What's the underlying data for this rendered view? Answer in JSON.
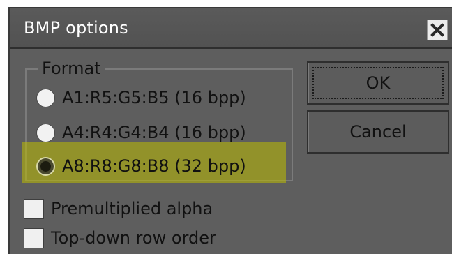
{
  "dialog": {
    "title": "BMP options",
    "close_icon": "close-icon"
  },
  "format_group": {
    "legend": "Format",
    "options": [
      {
        "label": "A1:R5:G5:B5 (16 bpp)",
        "selected": false
      },
      {
        "label": "A4:R4:G4:B4 (16 bpp)",
        "selected": false
      },
      {
        "label": "A8:R8:G8:B8 (32 bpp)",
        "selected": true
      }
    ]
  },
  "checkboxes": [
    {
      "label": "Premultiplied alpha",
      "checked": false
    },
    {
      "label": "Top-down row order",
      "checked": false
    }
  ],
  "buttons": {
    "ok_label": "OK",
    "cancel_label": "Cancel"
  },
  "colors": {
    "dialog_background": "#5e5e5e",
    "highlight": "#bebe00"
  }
}
